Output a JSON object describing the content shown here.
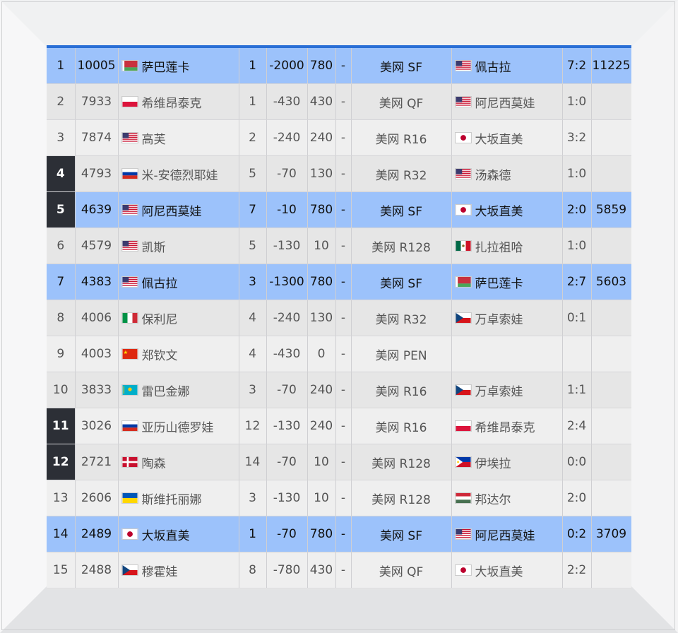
{
  "columns": [
    "rank",
    "points",
    "player",
    "played",
    "points_drop",
    "drop_pts",
    "dash",
    "last",
    "opponent",
    "score",
    "live"
  ],
  "rows": [
    {
      "rank": "1",
      "points": "10005",
      "flag": "belarus",
      "name": "萨巴莲卡",
      "played": "1",
      "change": "-2000",
      "drop": "780",
      "dash": "-",
      "round": "美网 SF",
      "opp_flag": "usa",
      "opp": "佩古拉",
      "score": "7:2",
      "live": "11225",
      "highlight": true,
      "dark": false
    },
    {
      "rank": "2",
      "points": "7933",
      "flag": "poland",
      "name": "希维昂泰克",
      "played": "1",
      "change": "-430",
      "drop": "430",
      "dash": "-",
      "round": "美网 QF",
      "opp_flag": "usa",
      "opp": "阿尼西莫娃",
      "score": "1:0",
      "live": "",
      "highlight": false,
      "dark": false
    },
    {
      "rank": "3",
      "points": "7874",
      "flag": "usa",
      "name": "高芙",
      "played": "2",
      "change": "-240",
      "drop": "240",
      "dash": "-",
      "round": "美网 R16",
      "opp_flag": "japan",
      "opp": "大坂直美",
      "score": "3:2",
      "live": "",
      "highlight": false,
      "dark": false
    },
    {
      "rank": "4",
      "points": "4793",
      "flag": "russia",
      "name": "米-安德烈耶娃",
      "played": "5",
      "change": "-70",
      "drop": "130",
      "dash": "-",
      "round": "美网 R32",
      "opp_flag": "usa",
      "opp": "汤森德",
      "score": "1:0",
      "live": "",
      "highlight": false,
      "dark": true
    },
    {
      "rank": "5",
      "points": "4639",
      "flag": "usa",
      "name": "阿尼西莫娃",
      "played": "7",
      "change": "-10",
      "drop": "780",
      "dash": "-",
      "round": "美网 SF",
      "opp_flag": "japan",
      "opp": "大坂直美",
      "score": "2:0",
      "live": "5859",
      "highlight": true,
      "dark": true
    },
    {
      "rank": "6",
      "points": "4579",
      "flag": "usa",
      "name": "凯斯",
      "played": "5",
      "change": "-130",
      "drop": "10",
      "dash": "-",
      "round": "美网 R128",
      "opp_flag": "mexico",
      "opp": "扎拉祖哈",
      "score": "1:0",
      "live": "",
      "highlight": false,
      "dark": false
    },
    {
      "rank": "7",
      "points": "4383",
      "flag": "usa",
      "name": "佩古拉",
      "played": "3",
      "change": "-1300",
      "drop": "780",
      "dash": "-",
      "round": "美网 SF",
      "opp_flag": "belarus",
      "opp": "萨巴莲卡",
      "score": "2:7",
      "live": "5603",
      "highlight": true,
      "dark": false
    },
    {
      "rank": "8",
      "points": "4006",
      "flag": "italy",
      "name": "保利尼",
      "played": "4",
      "change": "-240",
      "drop": "130",
      "dash": "-",
      "round": "美网 R32",
      "opp_flag": "czech",
      "opp": "万卓索娃",
      "score": "0:1",
      "live": "",
      "highlight": false,
      "dark": false
    },
    {
      "rank": "9",
      "points": "4003",
      "flag": "china",
      "name": "郑钦文",
      "played": "4",
      "change": "-430",
      "drop": "0",
      "dash": "-",
      "round": "美网 PEN",
      "opp_flag": "",
      "opp": "",
      "score": "",
      "live": "",
      "highlight": false,
      "dark": false
    },
    {
      "rank": "10",
      "points": "3833",
      "flag": "kazakhstan",
      "name": "雷巴金娜",
      "played": "3",
      "change": "-70",
      "drop": "240",
      "dash": "-",
      "round": "美网 R16",
      "opp_flag": "czech",
      "opp": "万卓索娃",
      "score": "1:1",
      "live": "",
      "highlight": false,
      "dark": false
    },
    {
      "rank": "11",
      "points": "3026",
      "flag": "russia",
      "name": "亚历山德罗娃",
      "played": "12",
      "change": "-130",
      "drop": "240",
      "dash": "-",
      "round": "美网 R16",
      "opp_flag": "poland",
      "opp": "希维昂泰克",
      "score": "2:4",
      "live": "",
      "highlight": false,
      "dark": true
    },
    {
      "rank": "12",
      "points": "2721",
      "flag": "denmark",
      "name": "陶森",
      "played": "14",
      "change": "-70",
      "drop": "10",
      "dash": "-",
      "round": "美网 R128",
      "opp_flag": "philippines",
      "opp": "伊埃拉",
      "score": "0:0",
      "live": "",
      "highlight": false,
      "dark": true
    },
    {
      "rank": "13",
      "points": "2606",
      "flag": "ukraine",
      "name": "斯维托丽娜",
      "played": "3",
      "change": "-130",
      "drop": "10",
      "dash": "-",
      "round": "美网 R128",
      "opp_flag": "hungary",
      "opp": "邦达尔",
      "score": "2:0",
      "live": "",
      "highlight": false,
      "dark": false
    },
    {
      "rank": "14",
      "points": "2489",
      "flag": "japan",
      "name": "大坂直美",
      "played": "1",
      "change": "-70",
      "drop": "780",
      "dash": "-",
      "round": "美网 SF",
      "opp_flag": "usa",
      "opp": "阿尼西莫娃",
      "score": "0:2",
      "live": "3709",
      "highlight": true,
      "dark": false
    },
    {
      "rank": "15",
      "points": "2488",
      "flag": "czech",
      "name": "穆霍娃",
      "played": "8",
      "change": "-780",
      "drop": "430",
      "dash": "-",
      "round": "美网 QF",
      "opp_flag": "japan",
      "opp": "大坂直美",
      "score": "2:2",
      "live": "",
      "highlight": false,
      "dark": false
    }
  ],
  "colors": {
    "highlight": "#9cc2fb",
    "accent": "#2a6fd6",
    "dark_rank": "#2c2f36"
  }
}
